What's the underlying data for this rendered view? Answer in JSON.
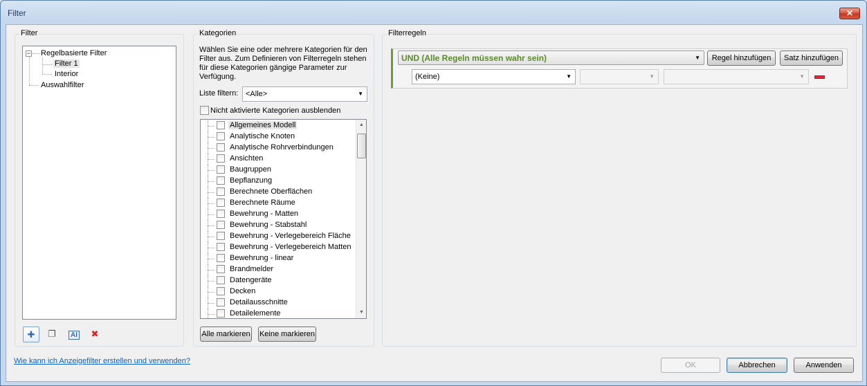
{
  "window": {
    "title": "Filter",
    "close_glyph": "✕"
  },
  "filter_group": {
    "title": "Filter",
    "tree": {
      "root_label": "Regelbasierte Filter",
      "root_expander": "−",
      "children": [
        "Filter 1",
        "Interior"
      ],
      "selection_label": "Auswahlfilter"
    },
    "toolbar_icons": [
      "new-filter-icon",
      "duplicate-filter-icon",
      "rename-filter-icon",
      "delete-filter-icon"
    ]
  },
  "categories_group": {
    "title": "Kategorien",
    "description": "Wählen Sie eine oder mehrere Kategorien für den Filter aus. Zum Definieren von Filterregeln stehen für diese Kategorien gängige Parameter zur Verfügung.",
    "list_filter_label": "Liste filtern:",
    "list_filter_value": "<Alle>",
    "hide_unchecked_label": "Nicht aktivierte Kategorien ausblenden",
    "items": [
      "Allgemeines Modell",
      "Analytische Knoten",
      "Analytische Rohrverbindungen",
      "Ansichten",
      "Baugruppen",
      "Bepflanzung",
      "Berechnete Oberflächen",
      "Berechnete Räume",
      "Bewehrung - Matten",
      "Bewehrung - Stabstahl",
      "Bewehrung - Verlegebereich Fläche",
      "Bewehrung - Verlegebereich Matten",
      "Bewehrung - linear",
      "Brandmelder",
      "Datengeräte",
      "Decken",
      "Detailausschnitte",
      "Detailelemente"
    ],
    "select_all_label": "Alle markieren",
    "select_none_label": "Keine markieren"
  },
  "rules_group": {
    "title": "Filterregeln",
    "logic_value": "UND (Alle Regeln müssen wahr sein)",
    "add_rule_label": "Regel hinzufügen",
    "add_set_label": "Satz hinzufügen",
    "parameter_value": "(Keine)",
    "operator_value": "",
    "value_value": ""
  },
  "footer": {
    "help_link": "Wie kann ich Anzeigefilter erstellen und verwenden?",
    "ok_label": "OK",
    "cancel_label": "Abbrechen",
    "apply_label": "Anwenden"
  },
  "colors": {
    "logic_text": "#5a8a28",
    "rule_accent": "#6f9a3f",
    "remove_rule": "#e0293a",
    "link": "#0b63c8"
  }
}
